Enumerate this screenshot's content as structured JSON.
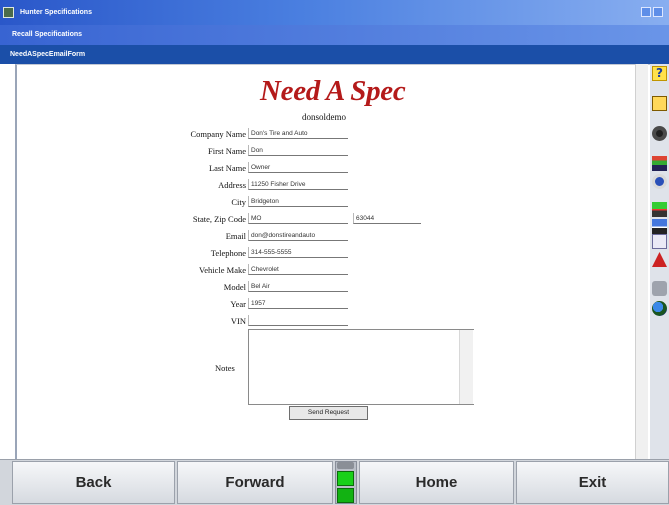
{
  "window": {
    "title": "Hunter Specifications",
    "subtitle": "Recall Specifications",
    "form_name": "NeedASpecEmailForm"
  },
  "icons": {
    "app": "app-icon",
    "minimize": "minimize-icon",
    "close": "close-icon",
    "toolbar": [
      "help-icon",
      "vehicle-icon",
      "wheel-icon",
      "alignment-icon",
      "sensor-icon",
      "camber-icon",
      "toe-icon",
      "document-icon",
      "warning-icon",
      "tool-icon",
      "globe-icon"
    ]
  },
  "form": {
    "title": "Need A Spec",
    "subtitle": "donsoldemo",
    "fields": {
      "company_name": {
        "label": "Company Name",
        "value": "Don's Tire and Auto"
      },
      "first_name": {
        "label": "First Name",
        "value": "Don"
      },
      "last_name": {
        "label": "Last Name",
        "value": "Owner"
      },
      "address": {
        "label": "Address",
        "value": "11250 Fisher Drive"
      },
      "city": {
        "label": "City",
        "value": "Bridgeton"
      },
      "state_zip": {
        "label": "State, Zip Code",
        "state": "MO",
        "zip": "63044"
      },
      "email": {
        "label": "Email",
        "value": "don@donstireandauto"
      },
      "telephone": {
        "label": "Telephone",
        "value": "314-555-5555"
      },
      "vehicle_make": {
        "label": "Vehicle Make",
        "value": "Chevrolet"
      },
      "model": {
        "label": "Model",
        "value": "Bel Air"
      },
      "year": {
        "label": "Year",
        "value": "1957"
      },
      "vin": {
        "label": "VIN",
        "value": ""
      },
      "notes": {
        "label": "Notes",
        "value": ""
      }
    },
    "send_label": "Send Request"
  },
  "nav": {
    "back": "Back",
    "forward": "Forward",
    "home": "Home",
    "exit": "Exit"
  },
  "colors": {
    "title_red": "#b41a1a",
    "header_blue": "#1b4fa8",
    "status_green": "#19d019"
  }
}
